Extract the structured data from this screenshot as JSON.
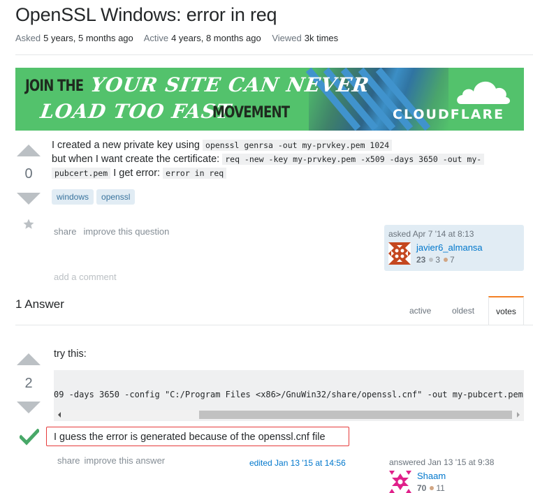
{
  "question": {
    "title": "OpenSSL Windows: error in req",
    "meta": [
      {
        "key": "Asked",
        "value": "5 years, 5 months ago"
      },
      {
        "key": "Active",
        "value": "4 years, 8 months ago"
      },
      {
        "key": "Viewed",
        "value": "3k times"
      }
    ],
    "votes": "0",
    "body": {
      "line1_text": "I created a new private key using",
      "line1_code": "openssl genrsa -out my-prvkey.pem 1024",
      "line2_text": "but when I want create the certificate:",
      "line2_code_a": "req -new -key my-prvkey.pem -x509 -days 3650 -out my-",
      "line3_code_b": "pubcert.pem",
      "line3_text": "I get error:",
      "line3_code": "error in req"
    },
    "tags": [
      "windows",
      "openssl"
    ],
    "menu": {
      "share": "share",
      "improve": "improve this question"
    },
    "add_comment": "add a comment",
    "user_card": {
      "action": "asked Apr 7 '14 at 8:13",
      "name": "javier6_almansa",
      "reputation": "23",
      "silver": "3",
      "bronze": "7"
    }
  },
  "ad": {
    "line1_dark": "JOIN THE",
    "line1_white": "YOUR SITE CAN NEVER",
    "line2_white": "LOAD TOO FAST",
    "line2_dark": "MOVEMENT",
    "brand": "CLOUDFLARE",
    "colors": {
      "background": "#53c26c",
      "accent": "#3f8ed8"
    }
  },
  "answers": {
    "heading": "1 Answer",
    "sort_tabs": [
      {
        "label": "active",
        "selected": false
      },
      {
        "label": "oldest",
        "selected": false
      },
      {
        "label": "votes",
        "selected": true
      }
    ],
    "items": [
      {
        "votes": "2",
        "accepted": true,
        "intro": "try this:",
        "code": "09 -days 3650 -config \"C:/Program Files <x86>/GnuWin32/share/openssl.cnf\" -out my-pubcert.pem",
        "note": "I guess the error is generated because of the openssl.cnf file",
        "menu": {
          "share": "share",
          "improve": "improve this answer"
        },
        "edited": "edited Jan 13 '15 at 14:56",
        "user_card": {
          "action": "answered Jan 13 '15 at 9:38",
          "name": "Shaam",
          "reputation": "70",
          "bronze": "11"
        }
      }
    ]
  },
  "colors": {
    "link": "#0077cc",
    "tag_bg": "#e1ecf4",
    "tag_text": "#39739d",
    "accepted": "#48a868",
    "active_tab": "#f48024",
    "highlight_border": "#e63a3a",
    "silver": "#bbc0c4",
    "bronze": "#d1a684"
  }
}
